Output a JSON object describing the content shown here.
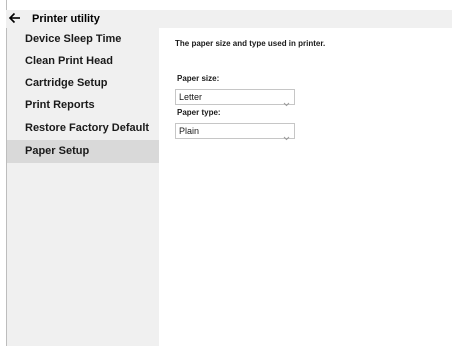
{
  "app": {
    "title": "Printer utility"
  },
  "sidebar": {
    "items": [
      {
        "label": "Device Sleep Time",
        "selected": false
      },
      {
        "label": "Clean Print Head",
        "selected": false
      },
      {
        "label": "Cartridge Setup",
        "selected": false
      },
      {
        "label": "Print Reports",
        "selected": false
      },
      {
        "label": "Restore Factory Default",
        "selected": false
      },
      {
        "label": "Paper Setup",
        "selected": true
      }
    ]
  },
  "main": {
    "description": "The paper size and type used in printer.",
    "paper_size": {
      "label": "Paper size:",
      "value": "Letter"
    },
    "paper_type": {
      "label": "Paper type:",
      "value": "Plain"
    }
  },
  "icons": {
    "back": "back-arrow-icon",
    "dropdown": "chevron-down-icon"
  },
  "colors": {
    "sidebar_bg": "#f0f0f0",
    "selected_bg": "#d9d9d9",
    "content_bg": "#ffffff"
  }
}
